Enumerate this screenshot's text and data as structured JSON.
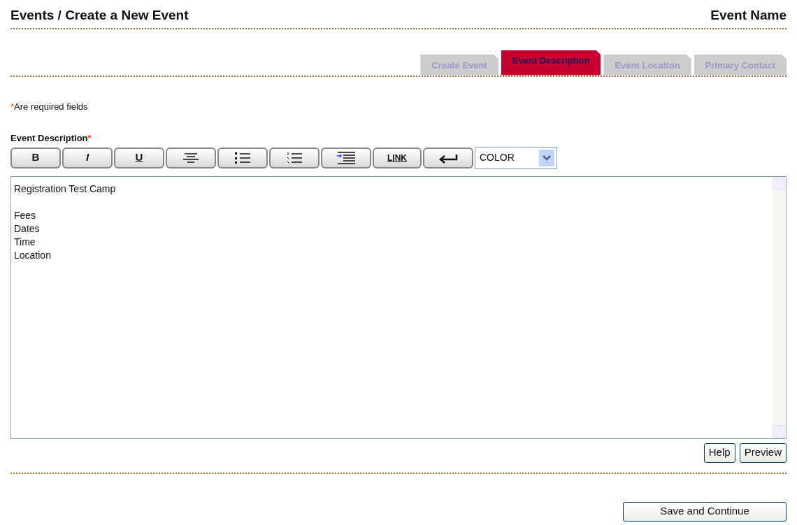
{
  "header": {
    "title": "Events / Create a New Event",
    "event_name": "Event Name"
  },
  "tabs": [
    {
      "label": "Create Event",
      "selected": false
    },
    {
      "label": "Event Description",
      "selected": true
    },
    {
      "label": "Event Location",
      "selected": false
    },
    {
      "label": "Primary Contact",
      "selected": false
    }
  ],
  "required_note": {
    "mark": "*",
    "text": "Are required fields"
  },
  "field": {
    "label": "Event Description",
    "mark": "*"
  },
  "toolbar": [
    {
      "kind": "bold",
      "label": "B"
    },
    {
      "kind": "italic",
      "label": "I"
    },
    {
      "kind": "underline",
      "label": "U"
    },
    {
      "kind": "align"
    },
    {
      "kind": "bullets"
    },
    {
      "kind": "numbers"
    },
    {
      "kind": "indent"
    },
    {
      "kind": "link",
      "label": "LINK"
    },
    {
      "kind": "enter"
    }
  ],
  "color_select": {
    "value": "COLOR"
  },
  "editor": {
    "value": "Registration Test Camp\n\nFees\nDates\nTime\nLocation"
  },
  "editor_buttons": [
    "Help",
    "Preview"
  ],
  "submit": "Save and Continue"
}
